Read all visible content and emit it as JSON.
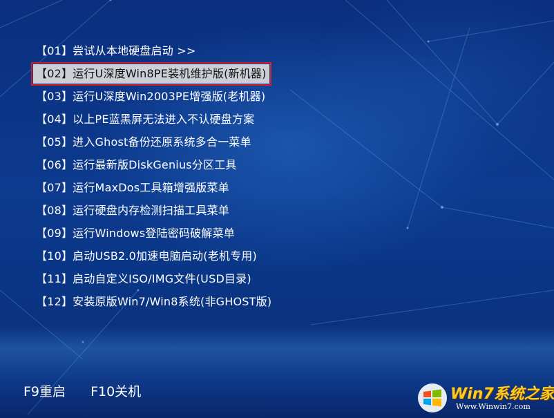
{
  "menu": {
    "items": [
      {
        "label": "【01】尝试从本地硬盘启动 >>"
      },
      {
        "label": "【02】运行U深度Win8PE装机维护版(新机器)"
      },
      {
        "label": "【03】运行U深度Win2003PE增强版(老机器)"
      },
      {
        "label": "【04】以上PE蓝黑屏无法进入不认硬盘方案"
      },
      {
        "label": "【05】进入Ghost备份还原系统多合一菜单"
      },
      {
        "label": "【06】运行最新版DiskGenius分区工具"
      },
      {
        "label": "【07】运行MaxDos工具箱增强版菜单"
      },
      {
        "label": "【08】运行硬盘内存检测扫描工具菜单"
      },
      {
        "label": "【09】运行Windows登陆密码破解菜单"
      },
      {
        "label": "【10】启动USB2.0加速电脑启动(老机专用)"
      },
      {
        "label": "【11】启动自定义ISO/IMG文件(USD目录)"
      },
      {
        "label": "【12】安装原版Win7/Win8系统(非GHOST版)"
      }
    ],
    "selected_index": 1
  },
  "footer": {
    "reboot": "F9重启",
    "shutdown": "F10关机"
  },
  "watermark": {
    "title": "Win7系统之家",
    "url": "Www.Winwin7.com"
  },
  "colors": {
    "background": "#0b2f7a",
    "text": "#ffffff",
    "selection_bg": "#ccd0d6",
    "selection_border": "#d2202a"
  }
}
